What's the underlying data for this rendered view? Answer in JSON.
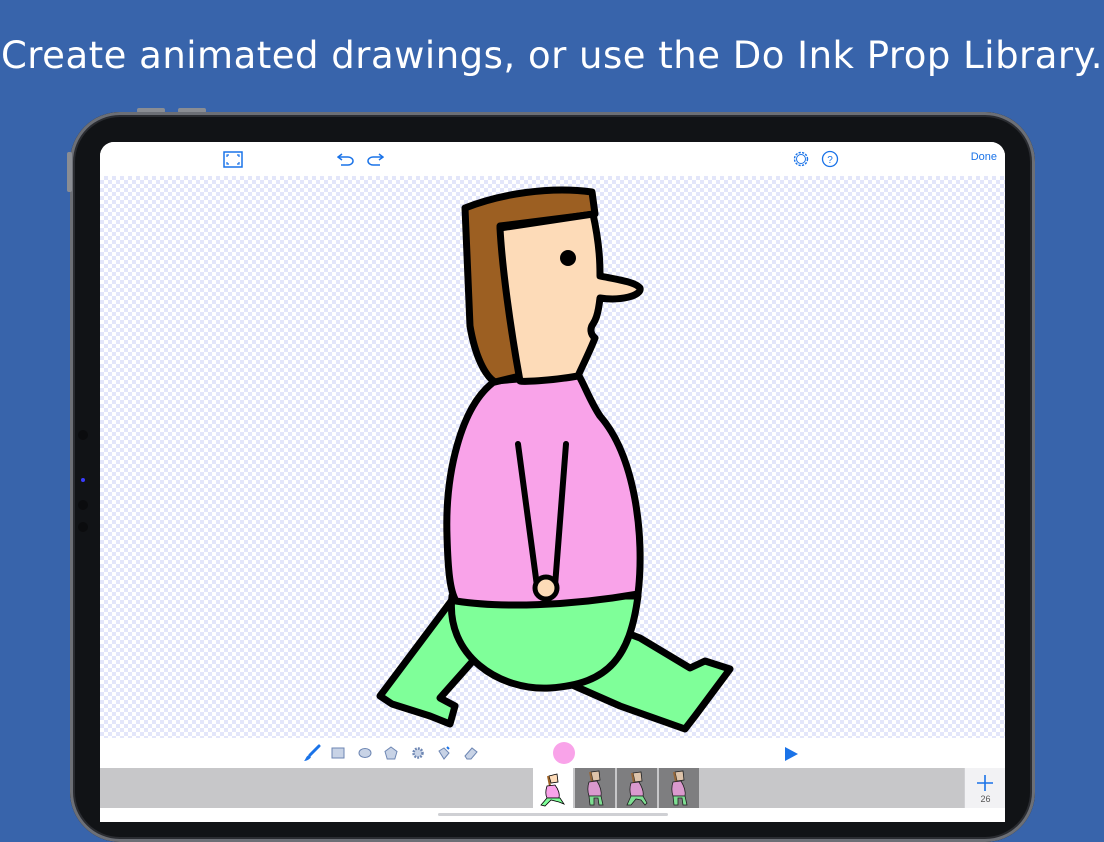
{
  "headline": "Create animated drawings, or use the Do Ink Prop Library.",
  "colors": {
    "background": "#3864ab",
    "accent": "#1a73e8",
    "current_color": "#f9a3e9",
    "shirt": "#f9a3e9",
    "pants": "#7fff99",
    "hair": "#9c5f22",
    "skin": "#fddbb8"
  },
  "topbar": {
    "icons": [
      "fullscreen-icon",
      "undo-icon",
      "redo-icon",
      "settings-gear-icon",
      "help-icon"
    ],
    "done_label": "Done"
  },
  "toolbar": {
    "tools": [
      "brush-tool-icon",
      "rectangle-tool-icon",
      "oval-tool-icon",
      "polygon-tool-icon",
      "gear-shape-tool-icon",
      "fill-bucket-tool-icon",
      "eraser-tool-icon"
    ],
    "play_icon": "play-icon"
  },
  "filmstrip": {
    "frames": [
      {
        "state": "active"
      },
      {
        "state": "inactive"
      },
      {
        "state": "inactive"
      },
      {
        "state": "inactive"
      }
    ],
    "add_icon": "plus-icon",
    "frame_count": "26"
  }
}
